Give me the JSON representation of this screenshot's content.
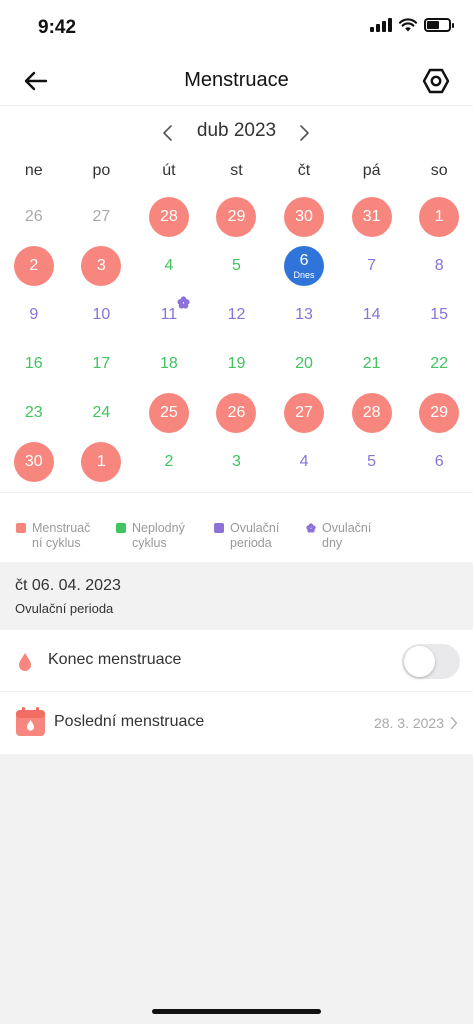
{
  "status": {
    "time": "9:42",
    "battery_level": 0.55
  },
  "header": {
    "title": "Menstruace",
    "back_icon": "arrow-left-icon",
    "settings_icon": "hexagon-settings-icon"
  },
  "calendar": {
    "month_label": "dub 2023",
    "weekdays": [
      "ne",
      "po",
      "út",
      "st",
      "čt",
      "pá",
      "so"
    ],
    "today_label": "Dnes",
    "weeks": [
      [
        {
          "d": "26",
          "t": "other"
        },
        {
          "d": "27",
          "t": "other"
        },
        {
          "d": "28",
          "t": "menses"
        },
        {
          "d": "29",
          "t": "menses"
        },
        {
          "d": "30",
          "t": "menses"
        },
        {
          "d": "31",
          "t": "menses"
        },
        {
          "d": "1",
          "t": "menses"
        }
      ],
      [
        {
          "d": "2",
          "t": "menses"
        },
        {
          "d": "3",
          "t": "menses"
        },
        {
          "d": "4",
          "t": "fertile"
        },
        {
          "d": "5",
          "t": "fertile"
        },
        {
          "d": "6",
          "t": "today"
        },
        {
          "d": "7",
          "t": "ovul"
        },
        {
          "d": "8",
          "t": "ovul"
        }
      ],
      [
        {
          "d": "9",
          "t": "ovul"
        },
        {
          "d": "10",
          "t": "ovul"
        },
        {
          "d": "11",
          "t": "ovul",
          "mark": "ovulation-day"
        },
        {
          "d": "12",
          "t": "ovul"
        },
        {
          "d": "13",
          "t": "ovul"
        },
        {
          "d": "14",
          "t": "ovul"
        },
        {
          "d": "15",
          "t": "ovul"
        }
      ],
      [
        {
          "d": "16",
          "t": "fertile"
        },
        {
          "d": "17",
          "t": "fertile"
        },
        {
          "d": "18",
          "t": "fertile"
        },
        {
          "d": "19",
          "t": "fertile"
        },
        {
          "d": "20",
          "t": "fertile"
        },
        {
          "d": "21",
          "t": "fertile"
        },
        {
          "d": "22",
          "t": "fertile"
        }
      ],
      [
        {
          "d": "23",
          "t": "fertile"
        },
        {
          "d": "24",
          "t": "fertile"
        },
        {
          "d": "25",
          "t": "menses"
        },
        {
          "d": "26",
          "t": "menses"
        },
        {
          "d": "27",
          "t": "menses"
        },
        {
          "d": "28",
          "t": "menses"
        },
        {
          "d": "29",
          "t": "menses"
        }
      ],
      [
        {
          "d": "30",
          "t": "menses"
        },
        {
          "d": "1",
          "t": "menses"
        },
        {
          "d": "2",
          "t": "fertile"
        },
        {
          "d": "3",
          "t": "fertile"
        },
        {
          "d": "4",
          "t": "ovul"
        },
        {
          "d": "5",
          "t": "ovul"
        },
        {
          "d": "6",
          "t": "ovul"
        }
      ]
    ]
  },
  "legend": [
    {
      "line1": "Menstruač",
      "line2": "ní cyklus",
      "color": "#f7877e",
      "shape": "square"
    },
    {
      "line1": "Neplodný",
      "line2": "cyklus",
      "color": "#3fc45f",
      "shape": "square"
    },
    {
      "line1": "Ovulační",
      "line2": "perioda",
      "color": "#8a72d8",
      "shape": "square"
    },
    {
      "line1": "Ovulační",
      "line2": "dny",
      "color": "#8a72d8",
      "shape": "flower"
    }
  ],
  "selected_day": {
    "date": "čt 06. 04. 2023",
    "status": "Ovulační perioda"
  },
  "end_of_menses": {
    "label": "Konec menstruace",
    "enabled": false
  },
  "last_menses": {
    "label": "Poslední menstruace",
    "value": "28. 3. 2023"
  },
  "colors": {
    "menses": "#f7877e",
    "today": "#2e74d9",
    "fertile": "#3fc45f",
    "ovulation": "#8a72d8",
    "other": "#a9a9a9"
  }
}
